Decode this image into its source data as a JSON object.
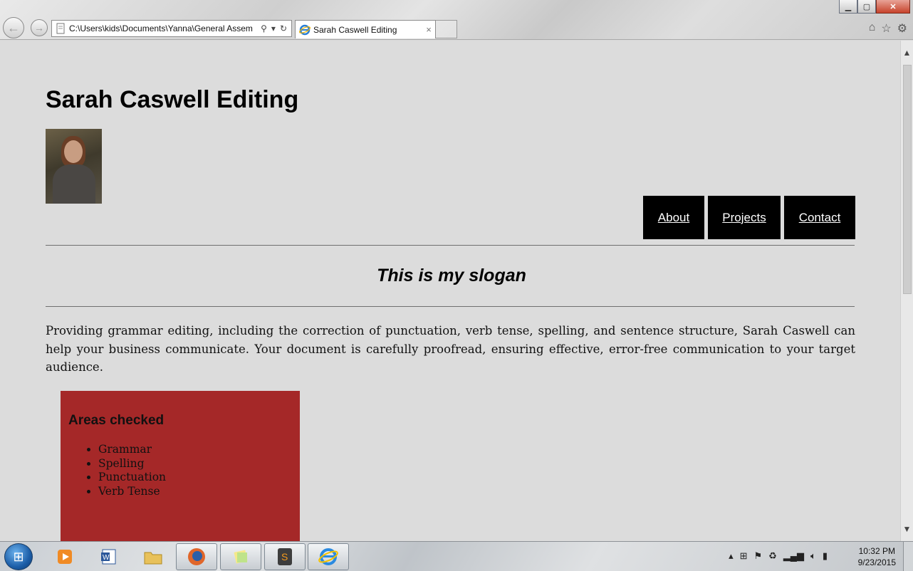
{
  "browser": {
    "address": "C:\\Users\\kids\\Documents\\Yanna\\General Assem",
    "tab_title": "Sarah Caswell Editing",
    "back_label": "←",
    "forward_label": "→",
    "tab_close": "×"
  },
  "page": {
    "title": "Sarah Caswell Editing",
    "nav": [
      "About",
      "Projects",
      "Contact"
    ],
    "slogan": "This is my slogan",
    "intro": "Providing grammar editing, including the correction of punctuation, verb tense, spelling, and sentence structure, Sarah Caswell can help your business communicate. Your document is carefully proofread, ensuring effective, error-free communication to your target audience.",
    "box": {
      "heading": "Areas checked",
      "items": [
        "Grammar",
        "Spelling",
        "Punctuation",
        "Verb Tense"
      ],
      "color": "#a52828"
    }
  },
  "taskbar": {
    "time": "10:32 PM",
    "date": "9/23/2015"
  },
  "icons": {
    "back": "arrow-left-icon",
    "forward": "arrow-right-icon",
    "search": "search-icon",
    "refresh": "refresh-icon",
    "home": "home-icon",
    "favorites": "star-icon",
    "settings": "gear-icon"
  }
}
